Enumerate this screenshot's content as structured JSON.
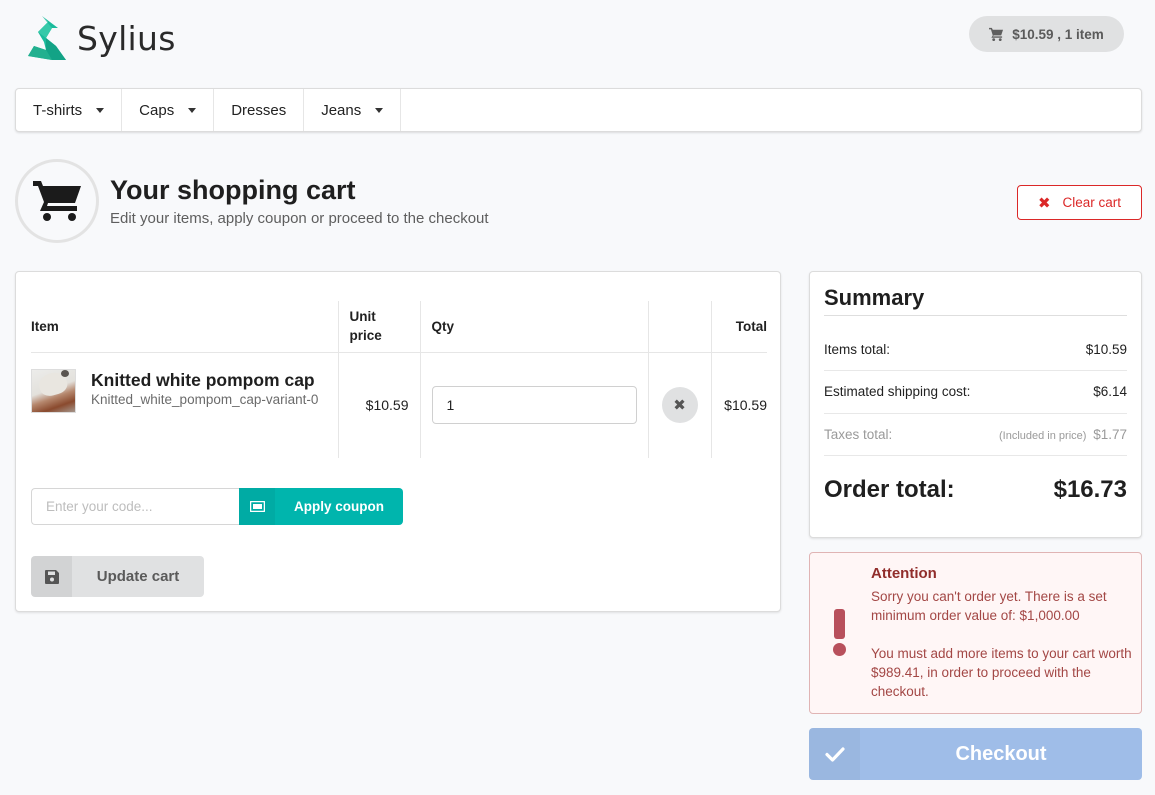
{
  "brand": {
    "name": "Sylius",
    "accent_color": "#1abb9c"
  },
  "header": {
    "cart_summary": "$10.59 , 1 item",
    "cart_icon": "shopping-cart-icon"
  },
  "menu": {
    "items": [
      {
        "label": "T-shirts",
        "has_dropdown": true
      },
      {
        "label": "Caps",
        "has_dropdown": true
      },
      {
        "label": "Dresses",
        "has_dropdown": false
      },
      {
        "label": "Jeans",
        "has_dropdown": true
      }
    ]
  },
  "page": {
    "title": "Your shopping cart",
    "subtitle": "Edit your items, apply coupon or proceed to the checkout",
    "icon": "shopping-cart-icon",
    "clear_cart_label": "Clear cart",
    "clear_cart_color": "#db2828"
  },
  "cart": {
    "columns": [
      "Item",
      "Unit price",
      "Qty",
      "",
      "Total"
    ],
    "items": [
      {
        "name": "Knitted white pompom cap",
        "variant": "Knitted_white_pompom_cap-variant-0",
        "unit_price": "$10.59",
        "quantity": "1",
        "total": "$10.59"
      }
    ],
    "coupon": {
      "placeholder": "Enter your code...",
      "value": "",
      "button_label": "Apply coupon",
      "button_color": "#00b5ad"
    },
    "update_label": "Update cart"
  },
  "summary": {
    "title": "Summary",
    "items_total_label": "Items total:",
    "items_total": "$10.59",
    "shipping_label": "Estimated shipping cost:",
    "shipping": "$6.14",
    "taxes_label": "Taxes total:",
    "taxes_note": "(Included in price)",
    "taxes": "$1.77",
    "order_total_label": "Order total:",
    "order_total": "$16.73"
  },
  "attention": {
    "title": "Attention",
    "message_1": "Sorry you can't order yet. There is a set minimum order value of: $1,000.00",
    "message_2": "You must add more items to your cart worth $989.41, in order to proceed with the checkout."
  },
  "checkout": {
    "label": "Checkout",
    "color": "#9fbde8",
    "disabled": true
  }
}
